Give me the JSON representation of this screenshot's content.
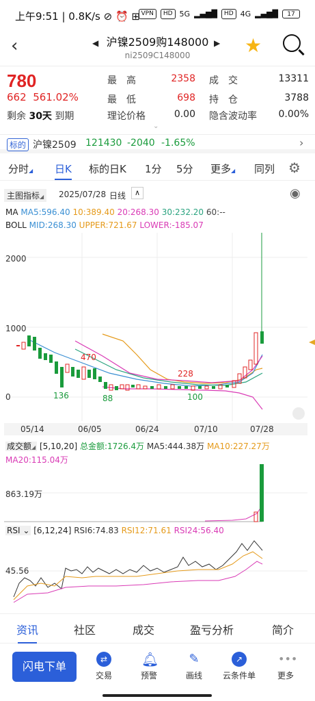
{
  "status": {
    "time": "上午9:51",
    "speed": "0.8K/s",
    "vpn": "VPN",
    "hd1": "HD",
    "net1": "5G",
    "hd2": "HD",
    "net2": "4G",
    "battery": "17"
  },
  "header": {
    "title": "沪镍2509购148000",
    "subtitle": "ni2509C148000"
  },
  "quote": {
    "price": "780",
    "change": "662",
    "change_pct": "561.02%",
    "remain_label": "剩余",
    "remain_days": "30天",
    "remain_suffix": "到期",
    "high_label": "最　高",
    "high": "2358",
    "low_label": "最　低",
    "low": "698",
    "theo_label": "理论价格",
    "theo": "0.00",
    "vol_label": "成　交",
    "vol": "13311",
    "oi_label": "持　仓",
    "oi": "3788",
    "iv_label": "隐含波动率",
    "iv": "0.00%"
  },
  "underlying": {
    "tag": "标的",
    "name": "沪镍2509",
    "price": "121430",
    "chg": "-2040",
    "pct": "-1.65%"
  },
  "tabs": [
    "分时",
    "日K",
    "标的日K",
    "1分",
    "5分",
    "更多",
    "同列"
  ],
  "chartbar": {
    "indicator": "主图指标",
    "date": "2025/07/28",
    "period": "日线"
  },
  "ma": {
    "label": "MA",
    "ma5": "MA5:596.40",
    "ma10": "10:389.40",
    "ma20": "20:268.30",
    "ma30": "30:232.20",
    "ma60": "60:--"
  },
  "boll": {
    "label": "BOLL",
    "mid": "MID:268.30",
    "upper": "UPPER:721.67",
    "lower": "LOWER:-185.07"
  },
  "chart_data": {
    "type": "candlestick",
    "y_ticks": [
      "2000",
      "1000",
      "0"
    ],
    "x_ticks": [
      "05/14",
      "06/05",
      "06/24",
      "07/10",
      "07/28"
    ],
    "annotations": [
      "2358",
      "470",
      "228",
      "136",
      "88",
      "100"
    ],
    "volume": {
      "label": "成交额",
      "params": "[5,10,20]",
      "total": "总金额:1726.4万",
      "ma5": "MA5:444.38万",
      "ma10": "MA10:227.27万",
      "ma20": "MA20:115.04万",
      "tick": "863.19万"
    },
    "rsi": {
      "label": "RSI",
      "params": "[6,12,24]",
      "rsi6": "RSI6:74.83",
      "rsi12": "RSI12:71.61",
      "rsi24": "RSI24:56.40",
      "tick": "45.56"
    }
  },
  "bottom_tabs": [
    "资讯",
    "社区",
    "成交",
    "盈亏分析",
    "简介"
  ],
  "actions": {
    "flash": "闪电下单",
    "trade": "交易",
    "alert": "预警",
    "draw": "画线",
    "cloud": "云条件单",
    "more": "更多"
  }
}
